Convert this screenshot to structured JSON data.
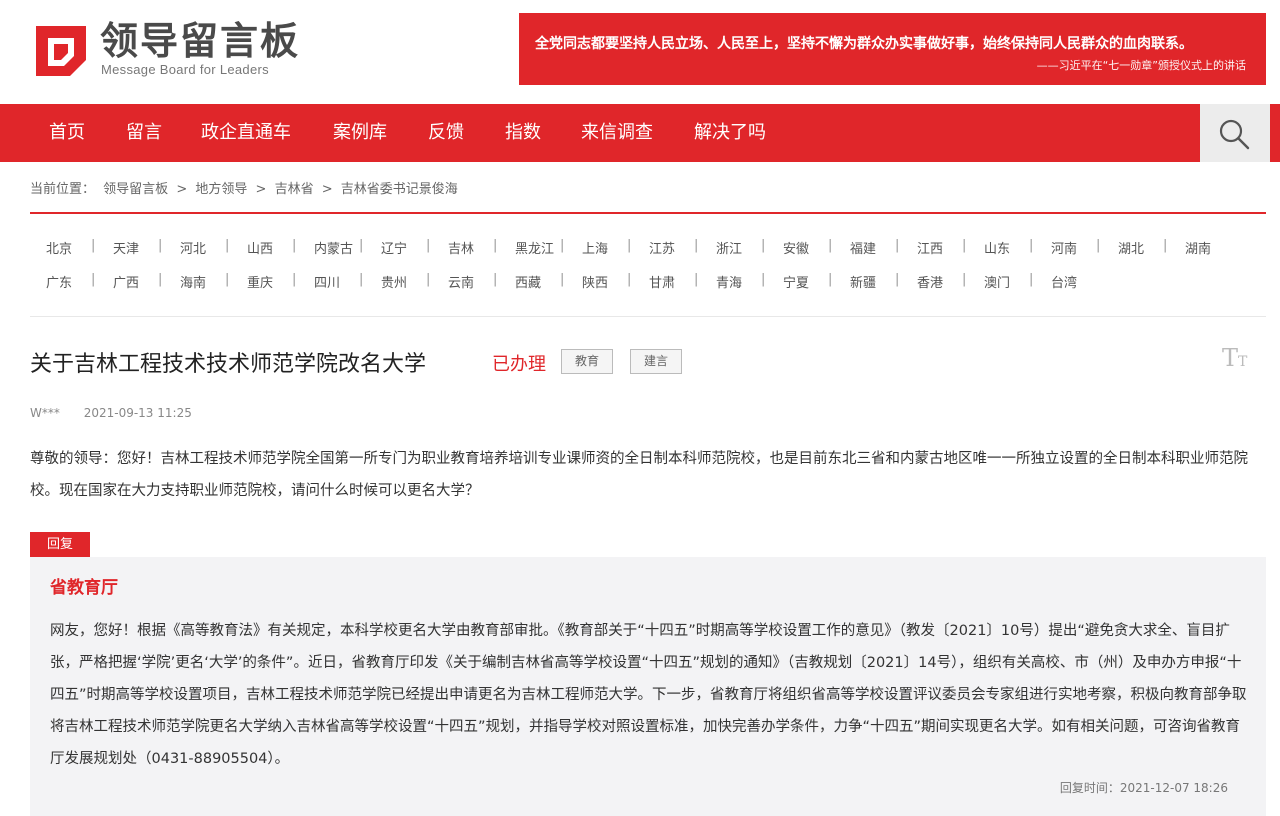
{
  "brand": {
    "title": "领导留言板",
    "subtitle": "Message Board for Leaders"
  },
  "banner": {
    "main": "全党同志都要坚持人民立场、人民至上，坚持不懈为群众办实事做好事，始终保持同人民群众的血肉联系。",
    "sub": "——习近平在“七一勋章”颁授仪式上的讲话"
  },
  "nav": [
    "首页",
    "留言",
    "政企直通车",
    "案例库",
    "反馈",
    "指数",
    "来信调查",
    "解决了吗"
  ],
  "breadcrumb": [
    "当前位置：",
    "领导留言板",
    ">",
    "地方领导",
    ">",
    "吉林省",
    ">",
    "吉林省委书记景俊海"
  ],
  "regions_row1": [
    "北京",
    "天津",
    "河北",
    "山西",
    "内蒙古",
    "辽宁",
    "吉林",
    "黑龙江",
    "上海",
    "江苏",
    "浙江",
    "安徽",
    "福建",
    "江西",
    "山东",
    "河南",
    "湖北",
    "湖南"
  ],
  "regions_row2": [
    "广东",
    "广西",
    "海南",
    "重庆",
    "四川",
    "贵州",
    "云南",
    "西藏",
    "陕西",
    "甘肃",
    "青海",
    "宁夏",
    "新疆",
    "香港",
    "澳门",
    "台湾"
  ],
  "message": {
    "title": "关于吉林工程技术技术师范学院改名大学",
    "status": "已办理",
    "tags": [
      "教育",
      "建言"
    ],
    "author": "W***",
    "date": "2021-09-13 11:25",
    "content": "尊敬的领导：您好！吉林工程技术师范学院全国第一所专门为职业教育培养培训专业课师资的全日制本科师范院校，也是目前东北三省和内蒙古地区唯一一所独立设置的全日制本科职业师范院校。现在国家在大力支持职业师范院校，请问什么时候可以更名大学？"
  },
  "reply": {
    "badge": "回复",
    "org": "省教育厅",
    "content": "网友，您好！根据《高等教育法》有关规定，本科学校更名大学由教育部审批。《教育部关于“十四五”时期高等学校设置工作的意见》（教发〔2021〕10号）提出“避免贪大求全、盲目扩张，严格把握‘学院’更名‘大学’的条件”。近日，省教育厅印发《关于编制吉林省高等学校设置“十四五”规划的通知》（吉教规划〔2021〕14号），组织有关高校、市（州）及申办方申报“十四五”时期高等学校设置项目，吉林工程技术师范学院已经提出申请更名为吉林工程师范大学。下一步，省教育厅将组织省高等学校设置评议委员会专家组进行实地考察，积极向教育部争取将吉林工程技术师范学院更名大学纳入吉林省高等学校设置“十四五”规划，并指导学校对照设置标准，加快完善办学条件，力争“十四五”期间实现更名大学。如有相关问题，可咨询省教育厅发展规划处（0431-88905504）。",
    "time_label": "回复时间：",
    "time": "2021-12-07 18:26"
  },
  "colors": {
    "accent": "#e0262a",
    "reply_bg": "#f3f3f5"
  },
  "icons": {
    "search": "search-icon",
    "font_size": "font-size-icon",
    "logo": "logo-icon"
  }
}
